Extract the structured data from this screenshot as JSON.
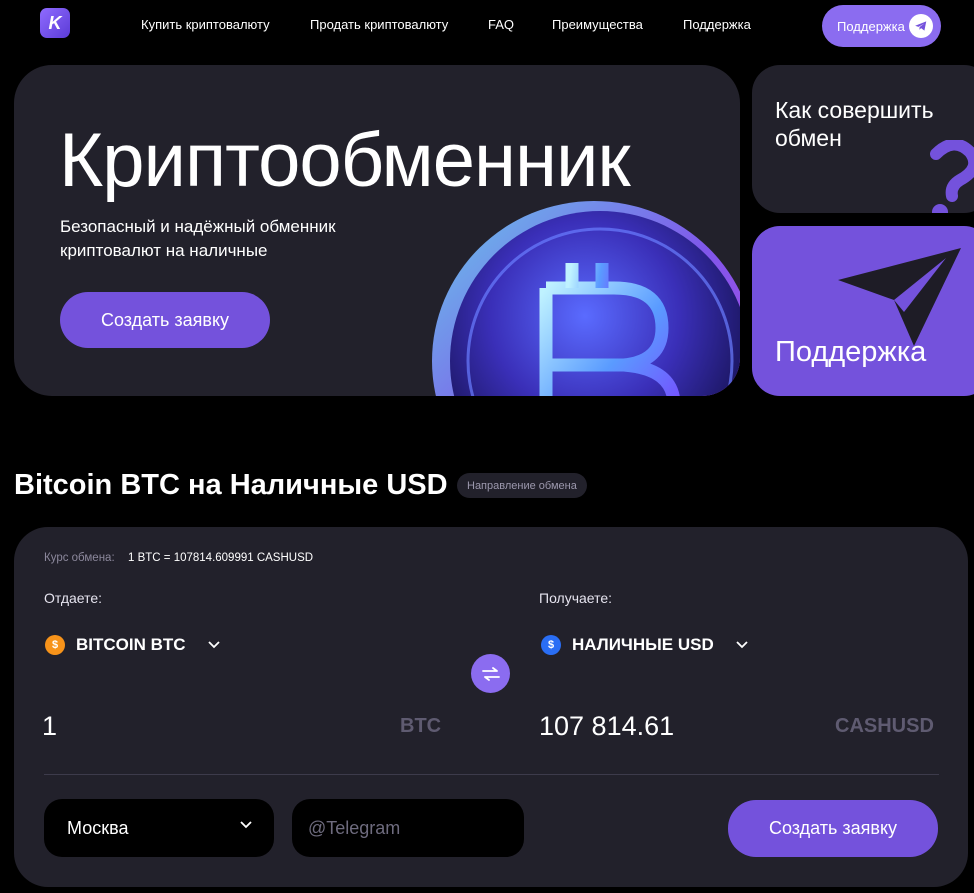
{
  "nav": {
    "logo_letter": "K",
    "links": [
      "Купить криптовалюту",
      "Продать криптовалюту",
      "FAQ",
      "Преимущества",
      "Поддержка"
    ],
    "support_button": "Поддержка"
  },
  "hero": {
    "title": "Криптообменник",
    "subtitle": "Безопасный и надёжный обменник криптовалют на наличные",
    "button": "Создать заявку"
  },
  "side_cards": {
    "how_to": "Как совершить обмен",
    "support": "Поддержка"
  },
  "exchange": {
    "title": "Bitcoin BTC на Наличные USD",
    "badge": "Направление обмена",
    "rate_label": "Курс обмена:",
    "rate_value": "1 BTC = 107814.609991 CASHUSD",
    "give_label": "Отдаете:",
    "receive_label": "Получаете:",
    "give_currency": "BITCOIN BTC",
    "receive_currency": "НАЛИЧНЫЕ USD",
    "give_amount": "1",
    "give_unit": "BTC",
    "receive_amount": "107 814.61",
    "receive_unit": "CASHUSD",
    "city": "Москва",
    "telegram_placeholder": "@Telegram",
    "submit": "Создать заявку"
  },
  "colors": {
    "background": "#000000",
    "card": "#22212b",
    "accent": "#7452dc",
    "accent_light": "#8b6cf0",
    "btc_orange": "#f7931a",
    "usd_blue": "#2a6ef5"
  },
  "icons": {
    "btc_coin": "$",
    "usd_coin": "$"
  }
}
